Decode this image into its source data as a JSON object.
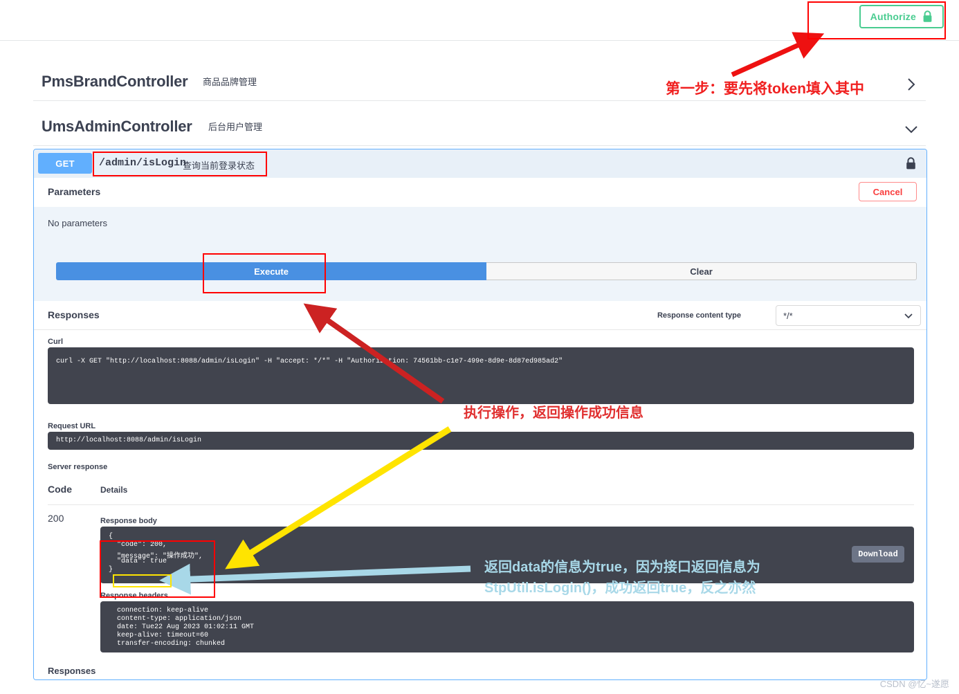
{
  "topbar": {
    "authorize_label": "Authorize",
    "lock_icon": "lock-icon",
    "accent_green": "#49cc90"
  },
  "sections": [
    {
      "title": "PmsBrandController",
      "description": "商品品牌管理",
      "expanded": false,
      "chevron": "chevron-right-icon"
    },
    {
      "title": "UmsAdminController",
      "description": "后台用户管理",
      "expanded": true,
      "chevron": "chevron-down-icon"
    }
  ],
  "operation": {
    "method": "GET",
    "path": "/admin/isLogin",
    "summary": "查询当前登录状态",
    "lock_icon": "lock-icon",
    "parameters_title": "Parameters",
    "cancel_label": "Cancel",
    "no_parameters": "No parameters",
    "execute_label": "Execute",
    "clear_label": "Clear",
    "responses_title": "Responses",
    "response_content_type_label": "Response content type",
    "response_content_type_value": "*/*",
    "curl_label": "Curl",
    "curl_command": "curl -X GET \"http://localhost:8088/admin/isLogin\" -H \"accept: */*\" -H \"Authorization: 74561bb-c1e7-499e-8d9e-8d87ed985ad2\"",
    "request_url_label": "Request URL",
    "request_url_value": "http://localhost:8088/admin/isLogin",
    "server_response_label": "Server response",
    "code_column": "Code",
    "details_column": "Details",
    "status_code": "200",
    "response_body_label": "Response body",
    "response_body_lines": [
      "{",
      "  \"code\": 200,",
      "  \"message\": \"操作成功\",",
      "  \"data\": true",
      "}"
    ],
    "download_label": "Download",
    "response_headers_label": "Response headers",
    "response_headers_lines": [
      "  connection: keep-alive ",
      "  content-type: application/json ",
      "  date: Tue22 Aug 2023 01:02:11 GMT ",
      "  keep-alive: timeout=60 ",
      "  transfer-encoding: chunked "
    ],
    "bottom_responses_title": "Responses"
  },
  "annotations": [
    {
      "id": "step-one",
      "text": "第一步：要先将token填入其中",
      "color": "#f02020"
    },
    {
      "id": "execute-note",
      "text": "执行操作，返回操作成功信息",
      "color": "#e03030"
    },
    {
      "id": "data-note-line1",
      "text": "返回data的信息为true，因为接口返回信息为",
      "color": "#a8d8e8"
    },
    {
      "id": "data-note-line2",
      "text": "StpUtil.isLogin()，成功返回true，反之亦然",
      "color": "#a8d8e8"
    }
  ],
  "watermark": "CSDN @忆~遂愿"
}
